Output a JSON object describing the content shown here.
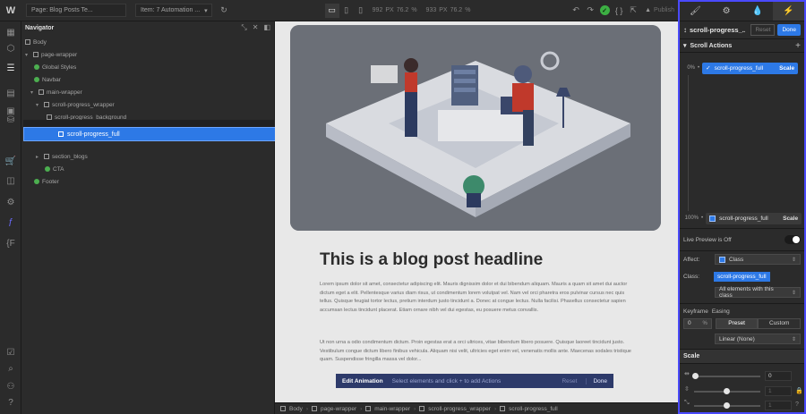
{
  "topbar": {
    "logo": "W",
    "page_label": "Page: Blog Posts Te...",
    "items_label": "Item: 7 Automation ...",
    "width_value": "992",
    "width_unit": "PX",
    "zoom1": "76.2",
    "zoom1_unit": "%",
    "height_value": "933",
    "height_unit": "PX",
    "zoom2": "76.2",
    "zoom2_unit": "%",
    "publish_label": "Publish"
  },
  "navigator": {
    "title": "Navigator",
    "tree": [
      {
        "label": "Body",
        "depth": 0,
        "icon": "box"
      },
      {
        "label": "page-wrapper",
        "depth": 1,
        "icon": "box"
      },
      {
        "label": "Global Styles",
        "depth": 2,
        "icon": "component"
      },
      {
        "label": "Navbar",
        "depth": 2,
        "icon": "component"
      },
      {
        "label": "main-wrapper",
        "depth": 2,
        "icon": "box"
      },
      {
        "label": "scroll-progress_wrapper",
        "depth": 3,
        "icon": "box"
      },
      {
        "label": "scroll-progress_background",
        "depth": 4,
        "icon": "box"
      },
      {
        "label": "section_blogs",
        "depth": 3,
        "icon": "box"
      },
      {
        "label": "CTA",
        "depth": 3,
        "icon": "component"
      },
      {
        "label": "Footer",
        "depth": 2,
        "icon": "component"
      }
    ],
    "drag_label": "scroll-progress_full"
  },
  "canvas": {
    "headline": "This is a blog post headline",
    "para1": "Lorem ipsum dolor sit amet, consectetur adipiscing elit. Mauris dignissim dolor et dui bibendum aliquam. Mauris a quam sit amet dui auctor dictum eget a elit. Pellentesque varius diam risus, ut condimentum lorem volutpat vel. Nam vel orci pharetra eros pulvinar cursus nec quis tellus. Quisque feugiat tortor lectus, pretium interdum justo tincidunt a. Donec at congue lectus. Nulla facilisi. Phasellus consectetur sapien accumsan lectus tincidunt placerat. Etiam ornare nibh vel dui egestas, eu posuere metus convallis.",
    "para2": "Ut non urna a odio condimentum dictum. Proin egestas erat a orci ultrices, vitae bibendum libero posuere. Quisque laoreet tincidunt justo. Vestibulum congue dictum libero finibus vehicula. Aliquam nisi velit, ultricies eget enim vel, venenatis mollis ante. Maecenas sodales tristique quam. Suspendisse fringilla massa vel dolor...",
    "anim_bar": {
      "title": "Edit Animation",
      "hint": "Select elements and click + to add Actions",
      "reset": "Reset",
      "done": "Done"
    }
  },
  "breadcrumbs": [
    "Body",
    "page-wrapper",
    "main-wrapper",
    "scroll-progress_wrapper",
    "scroll-progress_full"
  ],
  "rpanel": {
    "title": "scroll-progress_...",
    "reset": "Reset",
    "done": "Done",
    "scroll_actions": "Scroll Actions",
    "kf_start_pct": "0%",
    "kf_end_pct": "100%",
    "kf_label": "scroll-progress_full",
    "kf_tag": "Scale",
    "live_preview": "Live Preview is Off",
    "affect_label": "Affect:",
    "affect_value": "Class",
    "class_label": "Class:",
    "class_value": "scroll-progress_full",
    "scope_value": "All elements with this class",
    "keyframe_label": "Keyframe",
    "easing_label": "Easing",
    "keyframe_value": "0",
    "keyframe_unit": "%",
    "preset": "Preset",
    "custom": "Custom",
    "easing_value": "Linear (None)",
    "scale_head": "Scale",
    "scale_x": "0",
    "scale_y": "1",
    "scale_z": "1"
  }
}
